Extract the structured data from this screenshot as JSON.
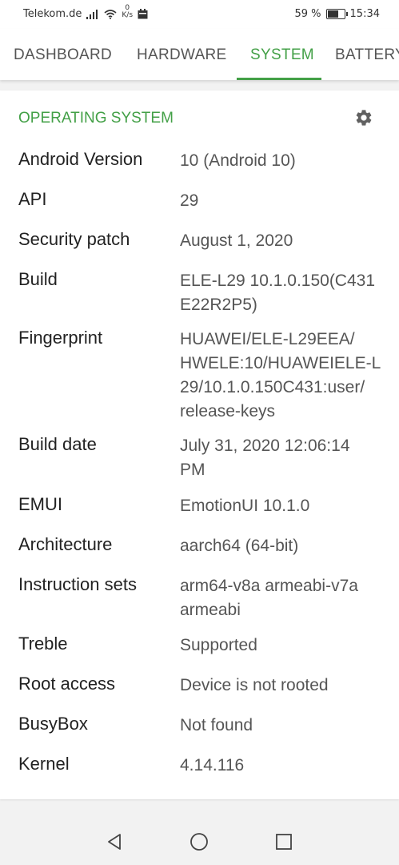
{
  "status_bar": {
    "carrier": "Telekom.de",
    "net_speed_value": "0",
    "net_speed_unit": "K/s",
    "battery_percent": "59 %",
    "battery_level": 0.59,
    "time": "15:34"
  },
  "tabs": [
    {
      "label": "DASHBOARD",
      "active": false
    },
    {
      "label": "HARDWARE",
      "active": false
    },
    {
      "label": "SYSTEM",
      "active": true
    },
    {
      "label": "BATTERY",
      "active": false
    }
  ],
  "section": {
    "title": "OPERATING SYSTEM",
    "settings_icon": "gear-icon"
  },
  "rows": [
    {
      "label": "Android Version",
      "value_lines": [
        "10 (Android 10)"
      ]
    },
    {
      "label": "API",
      "value_lines": [
        "29"
      ]
    },
    {
      "label": "Security patch",
      "value_lines": [
        "August 1, 2020"
      ]
    },
    {
      "label": "Build",
      "value_lines": [
        "ELE-L29 10.1.0.150(C431",
        "E22R2P5)"
      ]
    },
    {
      "label": "Fingerprint",
      "value_lines": [
        "HUAWEI/ELE-L29EEA/",
        "HWELE:10/HUAWEIELE-L",
        "29/10.1.0.150C431:user/",
        "release-keys"
      ]
    },
    {
      "label": "Build date",
      "value_lines": [
        "July 31, 2020 12:06:14",
        "PM"
      ]
    },
    {
      "label": "EMUI",
      "value_lines": [
        "EmotionUI 10.1.0"
      ]
    },
    {
      "label": "Architecture",
      "value_lines": [
        "aarch64 (64-bit)"
      ]
    },
    {
      "label": "Instruction sets",
      "value_lines": [
        "arm64-v8a armeabi-v7a",
        "armeabi"
      ]
    },
    {
      "label": "Treble",
      "value_lines": [
        "Supported"
      ]
    },
    {
      "label": "Root access",
      "value_lines": [
        "Device is not rooted"
      ]
    },
    {
      "label": "BusyBox",
      "value_lines": [
        "Not found"
      ]
    },
    {
      "label": "Kernel",
      "value_lines": [
        "4.14.116"
      ]
    }
  ],
  "nav_bar": {
    "back_icon": "back-triangle-icon",
    "home_icon": "home-circle-icon",
    "recents_icon": "recents-square-icon"
  },
  "colors": {
    "accent": "#43a047"
  }
}
